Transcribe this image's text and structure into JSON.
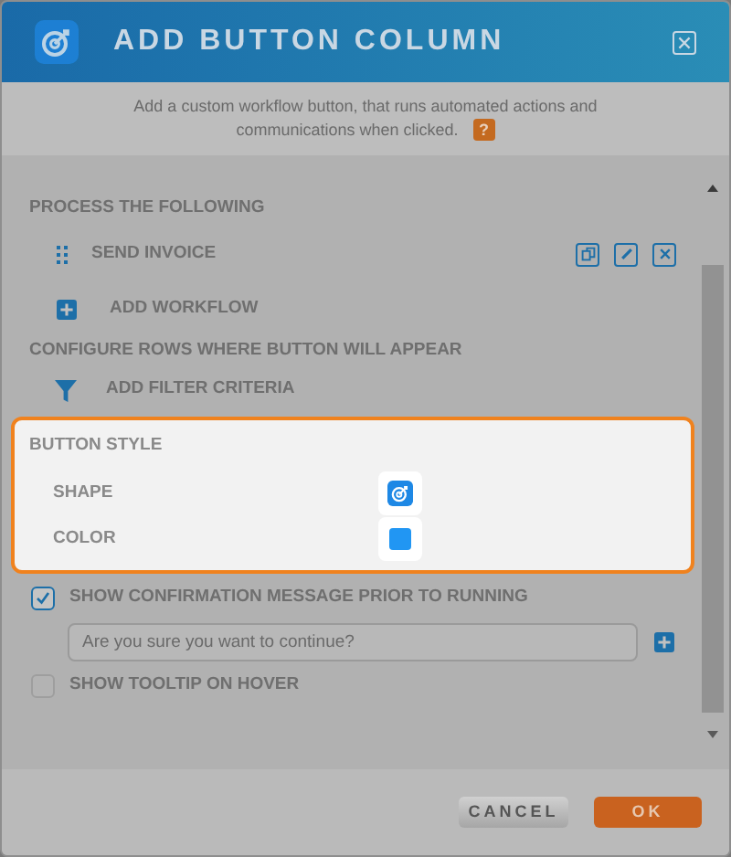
{
  "window": {
    "title": "ADD BUTTON COLUMN"
  },
  "description": "Add a custom workflow button, that runs automated actions and communications when clicked.",
  "help_badge": "?",
  "process": {
    "heading": "PROCESS THE FOLLOWING",
    "workflows": [
      {
        "label": "SEND INVOICE"
      }
    ],
    "add_label": "ADD WORKFLOW"
  },
  "filter": {
    "heading": "CONFIGURE ROWS WHERE BUTTON WILL APPEAR",
    "add_label": "ADD FILTER CRITERIA"
  },
  "button_style": {
    "heading": "BUTTON STYLE",
    "highlighted": true,
    "shape_label": "SHAPE",
    "color_label": "COLOR",
    "color": "#2196f3"
  },
  "options": [
    {
      "label": "SHOW CONFIRMATION MESSAGE PRIOR TO RUNNING",
      "checked": true,
      "message": "Are you sure you want to continue?"
    },
    {
      "label": "SHOW TOOLTIP ON HOVER",
      "checked": false
    }
  ],
  "buttons": [
    {
      "label": "CANCEL",
      "kind": "secondary"
    },
    {
      "label": "OK",
      "kind": "primary"
    }
  ]
}
